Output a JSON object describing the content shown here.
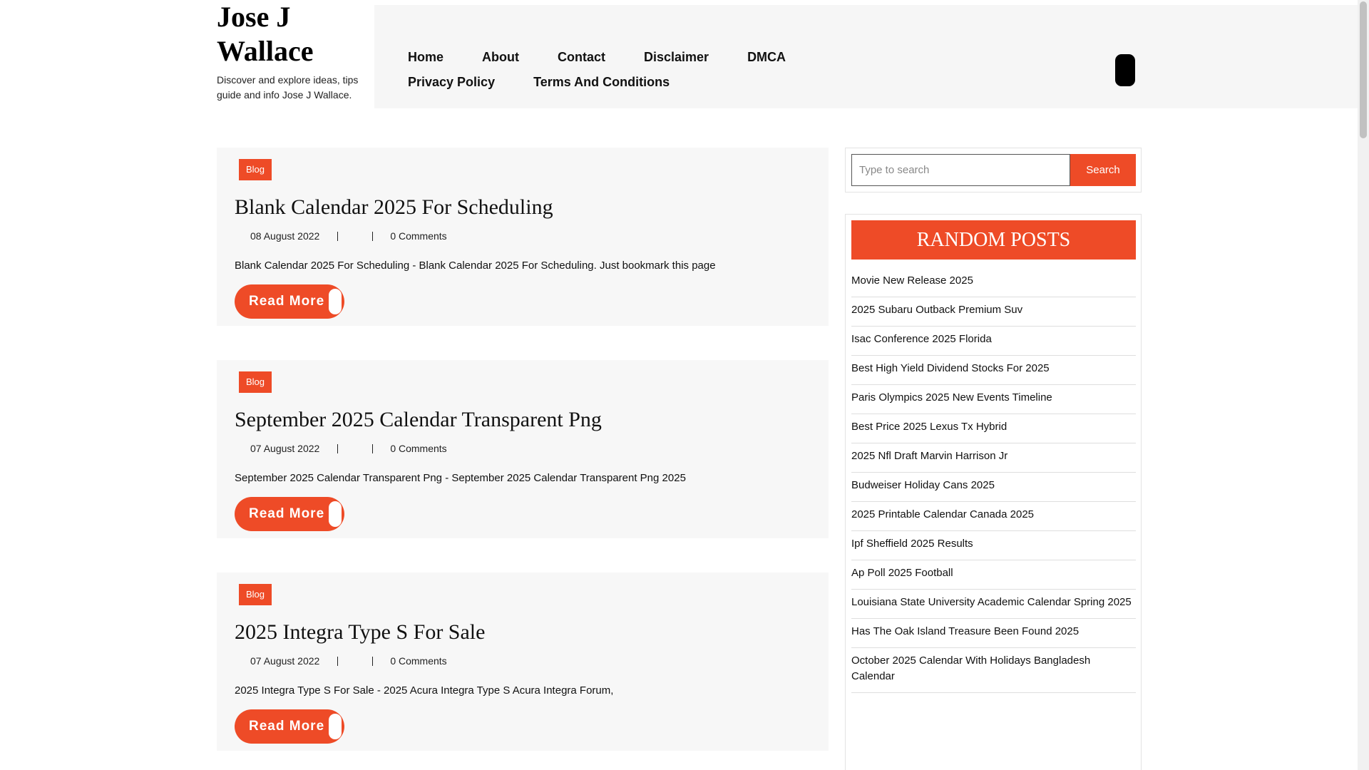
{
  "site": {
    "title": "Jose J Wallace",
    "tagline": "Discover and explore ideas, tips guide and info Jose J Wallace."
  },
  "nav": {
    "items": [
      "Home",
      "About",
      "Contact",
      "Disclaimer",
      "DMCA",
      "Privacy Policy",
      "Terms And Conditions"
    ]
  },
  "posts": [
    {
      "category": "Blog",
      "title": "Blank Calendar 2025 For Scheduling",
      "date": "08 August 2022",
      "comments": "0 Comments",
      "excerpt": "Blank Calendar 2025 For Scheduling - Blank Calendar 2025 For Scheduling. Just bookmark this page",
      "read_more": "Read More"
    },
    {
      "category": "Blog",
      "title": "September 2025 Calendar Transparent Png",
      "date": "07 August 2022",
      "comments": "0 Comments",
      "excerpt": "September 2025 Calendar Transparent Png - September 2025 Calendar Transparent Png 2025",
      "read_more": "Read More"
    },
    {
      "category": "Blog",
      "title": "2025 Integra Type S For Sale",
      "date": "07 August 2022",
      "comments": "0 Comments",
      "excerpt": "2025 Integra Type S For Sale - 2025 Acura Integra Type S Acura Integra Forum,",
      "read_more": "Read More"
    }
  ],
  "sidebar": {
    "search_placeholder": "Type to search",
    "search_button": "Search",
    "random_title": "RANDOM POSTS",
    "random_posts": [
      "Movie New Release 2025",
      "2025 Subaru Outback Premium Suv",
      "Isac Conference 2025 Florida",
      "Best High Yield Dividend Stocks For 2025",
      "Paris Olympics 2025 New Events Timeline",
      "Best Price 2025 Lexus Tx Hybrid",
      "2025 Nfl Draft Marvin Harrison Jr",
      "Budweiser Holiday Cans 2025",
      "2025 Printable Calendar Canada 2025",
      "Ipf Sheffield 2025 Results",
      "Ap Poll 2025 Football",
      "Louisiana State University Academic Calendar Spring 2025",
      "Has The Oak Island Treasure Been Found 2025",
      "October 2025 Calendar With Holidays Bangladesh Calendar"
    ]
  },
  "colors": {
    "accent": "#ee4b27",
    "card_bg": "#f7f7f7",
    "nav_bg": "#f6f6f6"
  }
}
